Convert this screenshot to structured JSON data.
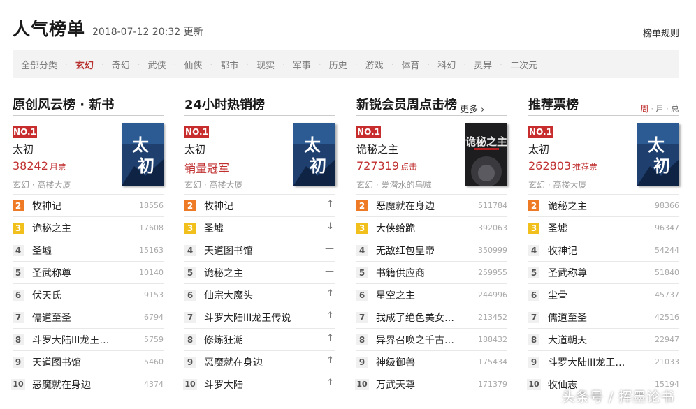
{
  "header": {
    "title": "人气榜单",
    "updated": "2018-07-12 20:32 更新",
    "rules_link": "榜单规则"
  },
  "categories": [
    "全部分类",
    "玄幻",
    "奇幻",
    "武侠",
    "仙侠",
    "都市",
    "现实",
    "军事",
    "历史",
    "游戏",
    "体育",
    "科幻",
    "灵异",
    "二次元"
  ],
  "active_category": "玄幻",
  "colors": {
    "accent": "#c03030",
    "rank2": "#ee7a26",
    "rank3": "#f1c01c"
  },
  "columns": [
    {
      "title": "原创风云榜 · 新书",
      "top": {
        "badge": "NO.1",
        "name": "太初",
        "stat": "38242",
        "stat_unit": "月票",
        "meta": "玄幻 · 高楼大厦",
        "cover": "太初"
      },
      "rows": [
        {
          "rank": "2",
          "name": "牧神记",
          "value": "18556"
        },
        {
          "rank": "3",
          "name": "诡秘之主",
          "value": "17608"
        },
        {
          "rank": "4",
          "name": "圣墟",
          "value": "15163"
        },
        {
          "rank": "5",
          "name": "圣武称尊",
          "value": "10140"
        },
        {
          "rank": "6",
          "name": "伏天氏",
          "value": "9153"
        },
        {
          "rank": "7",
          "name": "儒道至圣",
          "value": "6794"
        },
        {
          "rank": "8",
          "name": "斗罗大陆III龙王…",
          "value": "5759"
        },
        {
          "rank": "9",
          "name": "天道图书馆",
          "value": "5460"
        },
        {
          "rank": "10",
          "name": "恶魔就在身边",
          "value": "4374"
        }
      ]
    },
    {
      "title": "24小时热销榜",
      "top": {
        "badge": "NO.1",
        "name": "太初",
        "stat": "销量冠军",
        "stat_unit": "",
        "meta": "玄幻 · 高楼大厦",
        "cover": "太初"
      },
      "rows": [
        {
          "rank": "2",
          "name": "牧神记",
          "trend": "up"
        },
        {
          "rank": "3",
          "name": "圣墟",
          "trend": "down"
        },
        {
          "rank": "4",
          "name": "天道图书馆",
          "trend": "same"
        },
        {
          "rank": "5",
          "name": "诡秘之主",
          "trend": "same"
        },
        {
          "rank": "6",
          "name": "仙宗大魔头",
          "trend": "up"
        },
        {
          "rank": "7",
          "name": "斗罗大陆III龙王传说",
          "trend": "up"
        },
        {
          "rank": "8",
          "name": "修炼狂潮",
          "trend": "up"
        },
        {
          "rank": "9",
          "name": "恶魔就在身边",
          "trend": "up"
        },
        {
          "rank": "10",
          "name": "斗罗大陆",
          "trend": "up"
        }
      ]
    },
    {
      "title": "新锐会员周点击榜",
      "more": "更多 ›",
      "top": {
        "badge": "NO.1",
        "name": "诡秘之主",
        "stat": "727319",
        "stat_unit": "点击",
        "meta": "玄幻 · 爱潜水的乌贼",
        "cover": "诡秘之主"
      },
      "rows": [
        {
          "rank": "2",
          "name": "恶魔就在身边",
          "value": "511784"
        },
        {
          "rank": "3",
          "name": "大侠给跪",
          "value": "392063"
        },
        {
          "rank": "4",
          "name": "无敌红包皇帝",
          "value": "350999"
        },
        {
          "rank": "5",
          "name": "书籍供应商",
          "value": "259955"
        },
        {
          "rank": "6",
          "name": "星空之主",
          "value": "244996"
        },
        {
          "rank": "7",
          "name": "我成了绝色美女…",
          "value": "213452"
        },
        {
          "rank": "8",
          "name": "异界召唤之千古…",
          "value": "188432"
        },
        {
          "rank": "9",
          "name": "神级御兽",
          "value": "175434"
        },
        {
          "rank": "10",
          "name": "万武天尊",
          "value": "171379"
        }
      ]
    },
    {
      "title": "推荐票榜",
      "periods": [
        "周",
        "月",
        "总"
      ],
      "top": {
        "badge": "NO.1",
        "name": "太初",
        "stat": "262803",
        "stat_unit": "推荐票",
        "meta": "玄幻 · 高楼大厦",
        "cover": "太初"
      },
      "rows": [
        {
          "rank": "2",
          "name": "诡秘之主",
          "value": "98366"
        },
        {
          "rank": "3",
          "name": "圣墟",
          "value": "96347"
        },
        {
          "rank": "4",
          "name": "牧神记",
          "value": "54244"
        },
        {
          "rank": "5",
          "name": "圣武称尊",
          "value": "51840"
        },
        {
          "rank": "6",
          "name": "尘骨",
          "value": "45737"
        },
        {
          "rank": "7",
          "name": "儒道至圣",
          "value": "42516"
        },
        {
          "rank": "8",
          "name": "大道朝天",
          "value": "22947"
        },
        {
          "rank": "9",
          "name": "斗罗大陆III龙王…",
          "value": "21033"
        },
        {
          "rank": "10",
          "name": "牧仙志",
          "value": "15194"
        }
      ]
    }
  ],
  "watermark": "头条号 / 挥墨论书"
}
